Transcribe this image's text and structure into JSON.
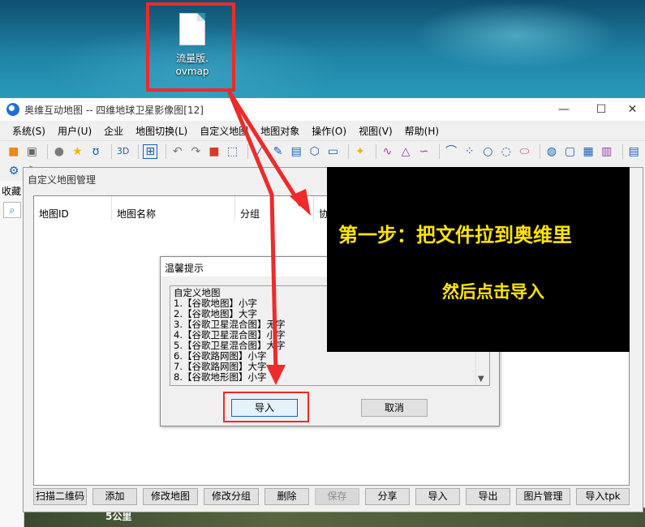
{
  "desktop": {
    "file_name_line1": "流量版.",
    "file_name_line2": "ovmap"
  },
  "window": {
    "title": "奥维互动地图 -- 四维地球卫星影像图[12]",
    "minimize": "—",
    "maximize": "☐",
    "close": "✕"
  },
  "menu": [
    "系统(S)",
    "用户(U)",
    "企业",
    "地图切换(L)",
    "自定义地图",
    "地图对象",
    "操作(O)",
    "视图(V)",
    "帮助(H)"
  ],
  "sidebar": {
    "tab_label": "收藏"
  },
  "map": {
    "scale_label": "5公里"
  },
  "map_manager": {
    "title": "自定义地图管理",
    "columns": [
      "地图ID",
      "地图名称",
      "分组",
      "协"
    ],
    "buttons": [
      "扫描二维码",
      "添加",
      "修改地图",
      "修改分组",
      "删除",
      "保存",
      "分享",
      "导入",
      "导出",
      "图片管理",
      "导入tpk"
    ]
  },
  "tip_dialog": {
    "title": "温馨提示",
    "lines": [
      "自定义地图",
      "1.【谷歌地图】小字",
      "2.【谷歌地图】大字",
      "3.【谷歌卫星混合图】无字",
      "4.【谷歌卫星混合图】小字",
      "5.【谷歌卫星混合图】大字",
      "6.【谷歌路网图】小字",
      "7.【谷歌路网图】大字",
      "8.【谷歌地形图】小字"
    ],
    "import_label": "导入",
    "cancel_label": "取消"
  },
  "annotation": {
    "line1": "第一步：把文件拉到奥维里",
    "line2": "然后点击导入"
  },
  "colors": {
    "annotation_text": "#ffe600",
    "highlight": "#ee2a2a"
  }
}
